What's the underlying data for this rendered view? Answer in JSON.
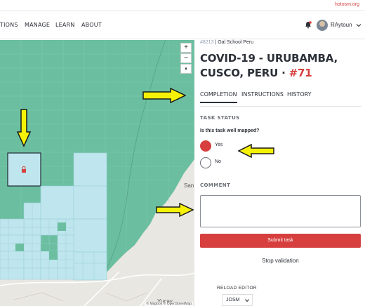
{
  "topbar": {
    "link_text": "hotosm.org"
  },
  "nav": {
    "items": [
      "TIONS",
      "MANAGE",
      "LEARN",
      "ABOUT"
    ],
    "username": "RAytoun"
  },
  "map": {
    "zoom_in": "+",
    "zoom_out": "−",
    "compass": "▲",
    "place_label_1": "San",
    "place_label_2": "Yucay",
    "attribution": "© Mapbox © OpenStreetMap"
  },
  "panel": {
    "project_id": "#8213",
    "organisation": "Gal School Peru",
    "title_text": "COVID-19 - URUBAMBA, CUSCO, PERU · ",
    "task_number": "#71",
    "tabs": [
      "COMPLETION",
      "INSTRUCTIONS",
      "HISTORY"
    ],
    "task_status_heading": "TASK STATUS",
    "question": "Is this task well mapped?",
    "options": [
      "Yes",
      "No"
    ],
    "comment_heading": "COMMENT",
    "submit_label": "Submit task",
    "stop_validation_label": "Stop validation",
    "reload_editor_label": "RELOAD EDITOR",
    "editor_value": "JOSM"
  },
  "colors": {
    "accent": "#d73f3f",
    "map_green": "#6bbfa0",
    "task_light": "#bfe6ee",
    "arrow_yellow": "#f5f207"
  }
}
